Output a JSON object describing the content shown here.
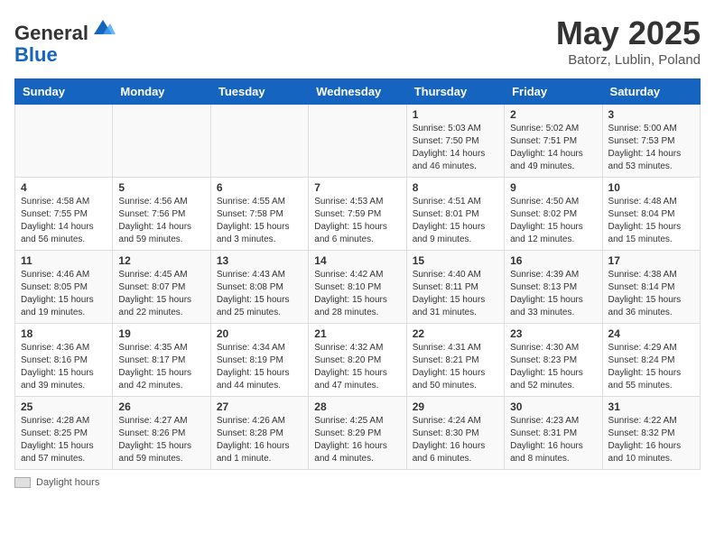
{
  "logo": {
    "general": "General",
    "blue": "Blue"
  },
  "header": {
    "month": "May 2025",
    "location": "Batorz, Lublin, Poland"
  },
  "weekdays": [
    "Sunday",
    "Monday",
    "Tuesday",
    "Wednesday",
    "Thursday",
    "Friday",
    "Saturday"
  ],
  "weeks": [
    [
      {
        "day": "",
        "info": ""
      },
      {
        "day": "",
        "info": ""
      },
      {
        "day": "",
        "info": ""
      },
      {
        "day": "",
        "info": ""
      },
      {
        "day": "1",
        "info": "Sunrise: 5:03 AM\nSunset: 7:50 PM\nDaylight: 14 hours\nand 46 minutes."
      },
      {
        "day": "2",
        "info": "Sunrise: 5:02 AM\nSunset: 7:51 PM\nDaylight: 14 hours\nand 49 minutes."
      },
      {
        "day": "3",
        "info": "Sunrise: 5:00 AM\nSunset: 7:53 PM\nDaylight: 14 hours\nand 53 minutes."
      }
    ],
    [
      {
        "day": "4",
        "info": "Sunrise: 4:58 AM\nSunset: 7:55 PM\nDaylight: 14 hours\nand 56 minutes."
      },
      {
        "day": "5",
        "info": "Sunrise: 4:56 AM\nSunset: 7:56 PM\nDaylight: 14 hours\nand 59 minutes."
      },
      {
        "day": "6",
        "info": "Sunrise: 4:55 AM\nSunset: 7:58 PM\nDaylight: 15 hours\nand 3 minutes."
      },
      {
        "day": "7",
        "info": "Sunrise: 4:53 AM\nSunset: 7:59 PM\nDaylight: 15 hours\nand 6 minutes."
      },
      {
        "day": "8",
        "info": "Sunrise: 4:51 AM\nSunset: 8:01 PM\nDaylight: 15 hours\nand 9 minutes."
      },
      {
        "day": "9",
        "info": "Sunrise: 4:50 AM\nSunset: 8:02 PM\nDaylight: 15 hours\nand 12 minutes."
      },
      {
        "day": "10",
        "info": "Sunrise: 4:48 AM\nSunset: 8:04 PM\nDaylight: 15 hours\nand 15 minutes."
      }
    ],
    [
      {
        "day": "11",
        "info": "Sunrise: 4:46 AM\nSunset: 8:05 PM\nDaylight: 15 hours\nand 19 minutes."
      },
      {
        "day": "12",
        "info": "Sunrise: 4:45 AM\nSunset: 8:07 PM\nDaylight: 15 hours\nand 22 minutes."
      },
      {
        "day": "13",
        "info": "Sunrise: 4:43 AM\nSunset: 8:08 PM\nDaylight: 15 hours\nand 25 minutes."
      },
      {
        "day": "14",
        "info": "Sunrise: 4:42 AM\nSunset: 8:10 PM\nDaylight: 15 hours\nand 28 minutes."
      },
      {
        "day": "15",
        "info": "Sunrise: 4:40 AM\nSunset: 8:11 PM\nDaylight: 15 hours\nand 31 minutes."
      },
      {
        "day": "16",
        "info": "Sunrise: 4:39 AM\nSunset: 8:13 PM\nDaylight: 15 hours\nand 33 minutes."
      },
      {
        "day": "17",
        "info": "Sunrise: 4:38 AM\nSunset: 8:14 PM\nDaylight: 15 hours\nand 36 minutes."
      }
    ],
    [
      {
        "day": "18",
        "info": "Sunrise: 4:36 AM\nSunset: 8:16 PM\nDaylight: 15 hours\nand 39 minutes."
      },
      {
        "day": "19",
        "info": "Sunrise: 4:35 AM\nSunset: 8:17 PM\nDaylight: 15 hours\nand 42 minutes."
      },
      {
        "day": "20",
        "info": "Sunrise: 4:34 AM\nSunset: 8:19 PM\nDaylight: 15 hours\nand 44 minutes."
      },
      {
        "day": "21",
        "info": "Sunrise: 4:32 AM\nSunset: 8:20 PM\nDaylight: 15 hours\nand 47 minutes."
      },
      {
        "day": "22",
        "info": "Sunrise: 4:31 AM\nSunset: 8:21 PM\nDaylight: 15 hours\nand 50 minutes."
      },
      {
        "day": "23",
        "info": "Sunrise: 4:30 AM\nSunset: 8:23 PM\nDaylight: 15 hours\nand 52 minutes."
      },
      {
        "day": "24",
        "info": "Sunrise: 4:29 AM\nSunset: 8:24 PM\nDaylight: 15 hours\nand 55 minutes."
      }
    ],
    [
      {
        "day": "25",
        "info": "Sunrise: 4:28 AM\nSunset: 8:25 PM\nDaylight: 15 hours\nand 57 minutes."
      },
      {
        "day": "26",
        "info": "Sunrise: 4:27 AM\nSunset: 8:26 PM\nDaylight: 15 hours\nand 59 minutes."
      },
      {
        "day": "27",
        "info": "Sunrise: 4:26 AM\nSunset: 8:28 PM\nDaylight: 16 hours\nand 1 minute."
      },
      {
        "day": "28",
        "info": "Sunrise: 4:25 AM\nSunset: 8:29 PM\nDaylight: 16 hours\nand 4 minutes."
      },
      {
        "day": "29",
        "info": "Sunrise: 4:24 AM\nSunset: 8:30 PM\nDaylight: 16 hours\nand 6 minutes."
      },
      {
        "day": "30",
        "info": "Sunrise: 4:23 AM\nSunset: 8:31 PM\nDaylight: 16 hours\nand 8 minutes."
      },
      {
        "day": "31",
        "info": "Sunrise: 4:22 AM\nSunset: 8:32 PM\nDaylight: 16 hours\nand 10 minutes."
      }
    ]
  ],
  "footer": {
    "label": "Daylight hours"
  }
}
